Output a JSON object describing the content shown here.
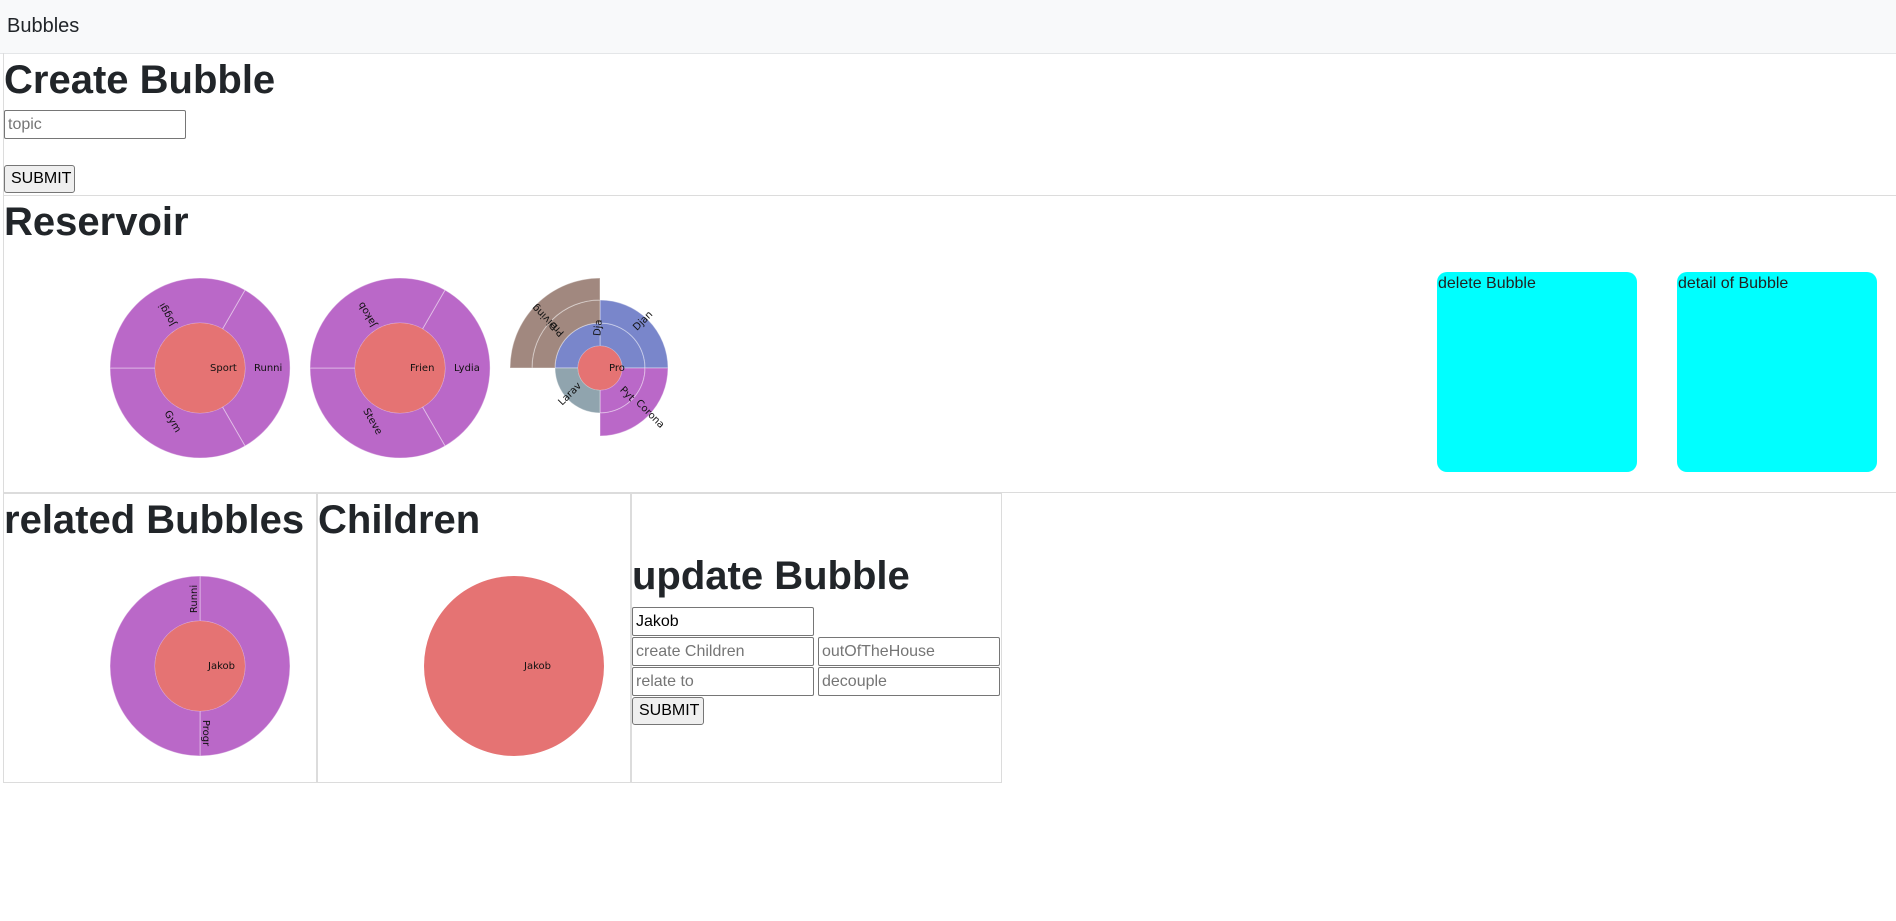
{
  "app": {
    "title": "Bubbles"
  },
  "create": {
    "title": "Create Bubble",
    "topic_placeholder": "topic",
    "submit_label": "SUBMIT"
  },
  "reservoir": {
    "title": "Reservoir",
    "bubbles": [
      {
        "center": "Sport",
        "children": [
          "Runni",
          "Gym",
          "Joggi"
        ]
      },
      {
        "center": "Frien",
        "children": [
          "Lydia",
          "Steve",
          "Jakob"
        ]
      },
      {
        "center": "Pro",
        "children": [
          "Dja",
          "Djan",
          "Pyt",
          "Corona",
          "Larav",
          "Pre",
          "Diving"
        ]
      }
    ],
    "delete_label": "delete Bubble",
    "detail_label": "detail of Bubble"
  },
  "related": {
    "title": "related Bubbles",
    "center": "Jakob",
    "children": [
      "Runni",
      "Progr"
    ]
  },
  "children_panel": {
    "title": "Children",
    "center": "Jakob"
  },
  "update": {
    "title": "update Bubble",
    "name_value": "Jakob",
    "create_children_placeholder": "create Children",
    "out_placeholder": "outOfTheHouse",
    "relate_placeholder": "relate to",
    "decouple_placeholder": "decouple",
    "submit_label": "SUBMIT"
  },
  "colors": {
    "navbar_bg": "#f8f9fa",
    "center": "#e57373",
    "purple": "#ba68c8",
    "blue": "#7986cb",
    "gray": "#90a4ae",
    "brown": "#a1887f",
    "cyan": "#00ffff"
  }
}
